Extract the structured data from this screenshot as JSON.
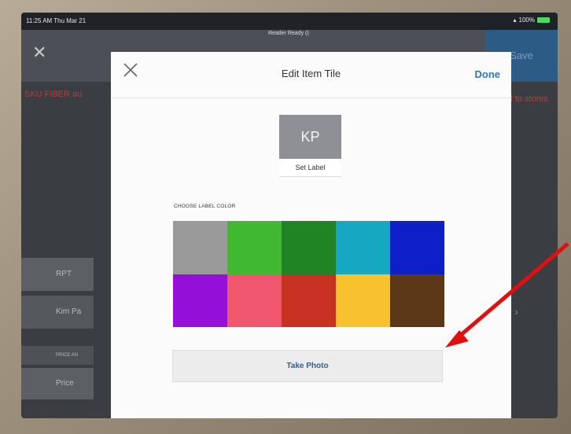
{
  "status_bar": {
    "time": "11:25 AM  Thu Mar 21",
    "reader": "Reader Ready ((·",
    "battery": "100%"
  },
  "background_app": {
    "save_label": "Save",
    "red_text_left": "SKU FIBER au",
    "red_text_right": "ned to stores",
    "row_1": "RPT",
    "row_2": "Kim Pa",
    "row_3": "PRICE AN",
    "row_4": "Price"
  },
  "modal": {
    "title": "Edit Item Tile",
    "done_label": "Done",
    "tile_initials": "KP",
    "set_label": "Set Label",
    "choose_color_label": "CHOOSE LABEL COLOR",
    "take_photo_label": "Take Photo",
    "colors": [
      "#9a9a9a",
      "#40b832",
      "#208424",
      "#16a8c0",
      "#0f1fc8",
      "#9410d8",
      "#f0566e",
      "#c83222",
      "#f8c22e",
      "#5c3818"
    ]
  },
  "annotation": {
    "arrow_color": "#e01010"
  }
}
